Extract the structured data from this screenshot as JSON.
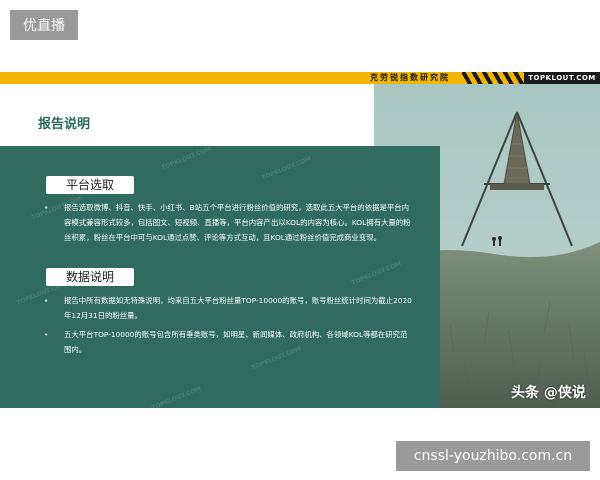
{
  "corner_tag": "优直播",
  "header": {
    "institute": "克劳锐指数研究院",
    "brand": "TOPKLOUT.COM"
  },
  "heading": "报告说明",
  "sections": [
    {
      "title": "平台选取",
      "bullets": [
        "报告选取微博、抖音、快手、小红书、B站五个平台进行粉丝价值的研究，选取此五大平台的依据是平台内容模式兼容形式较多，包括图文、短视频、直播等，平台内容产出以KOL的内容为核心。KOL拥有大量的粉丝积累，粉丝在平台中可与KOL通过点赞、评论等方式互动，且KOL通过粉丝价值完成商业变现。"
      ]
    },
    {
      "title": "数据说明",
      "bullets": [
        "报告中所有数据如无特殊说明，均来自五大平台粉丝量TOP-10000的账号，账号粉丝统计时间为截止2020年12月31日的粉丝量。",
        "五大平台TOP-10000的账号包含所有垂类账号，如明星、新闻媒体、政府机构、各领域KOL等都在研究范围内。"
      ]
    }
  ],
  "bullet_char": "•",
  "watermark": "TOPKLOUT.COM",
  "photo_credit": "头条 @侠说",
  "footer_url": "cnssl-youzhibo.com.cn",
  "colors": {
    "panel": "#2f6b5f",
    "accent_yellow": "#f2b600",
    "heading": "#2a6a5c"
  }
}
